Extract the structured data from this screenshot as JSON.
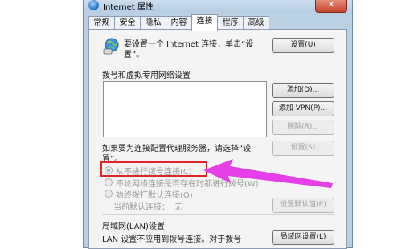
{
  "window": {
    "title": "Internet 属性",
    "close": "✕"
  },
  "tabs": [
    "常规",
    "安全",
    "隐私",
    "内容",
    "连接",
    "程序",
    "高级"
  ],
  "setup": {
    "text_line1": "要设置一个 Internet 连接，单击“设",
    "text_line2": "置”。",
    "button": "设置(U)"
  },
  "dialup": {
    "section_title": "拨号和虚拟专用网络设置",
    "add": "添加(D)...",
    "add_vpn": "添加 VPN(P)...",
    "delete": "删除(R)...",
    "proxy_line1": "如果要为连接配置代理服务器，请选择“设",
    "proxy_line2": "置”。",
    "settings": "设置(S)",
    "radio_never": "从不进行拨号连接(C)",
    "radio_when_no_network": "不论网络连接是否存在时都进行拨号(W)",
    "radio_always": "始终拨打默认连接(O)",
    "current_default_label": "当前默认连接：",
    "current_default_value": "无",
    "set_default": "设置默认值(E)"
  },
  "lan": {
    "section_title": "局域网(LAN)设置",
    "text": "LAN 设置不应用到拨号连接。对于拨号",
    "button": "局域网设置(L)"
  },
  "annotation": {
    "highlight_color": "#e0242a",
    "arrow_color": "#e63ee8"
  }
}
